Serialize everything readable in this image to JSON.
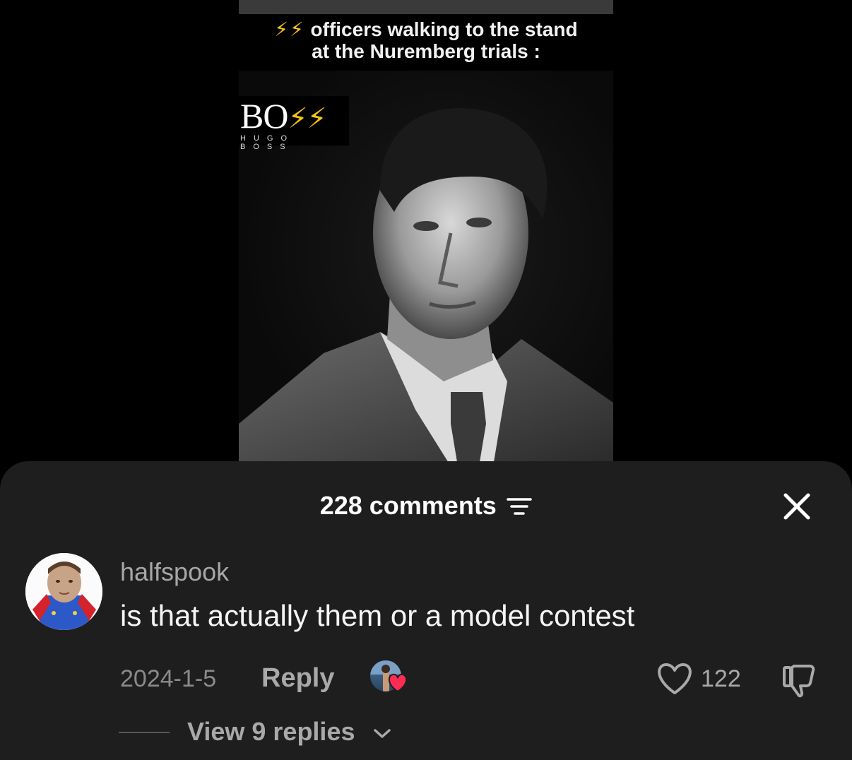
{
  "video": {
    "caption_bolts": "⚡⚡",
    "caption_line1": "officers walking to the stand",
    "caption_line2": "at the Nuremberg trials :",
    "logo_word": "BO",
    "logo_bolts": "⚡⚡",
    "logo_sub": "HUGO BOSS"
  },
  "comments": {
    "count_label": "228 comments",
    "filter_icon": "filter-icon",
    "close_icon": "close-icon"
  },
  "comment": {
    "username": "halfspook",
    "text": "is that actually them or a model contest",
    "date": "2024-1-5",
    "reply_label": "Reply",
    "like_count": "122",
    "view_replies_label": "View 9 replies"
  },
  "colors": {
    "sheet_bg": "#1e1e1e",
    "accent_heart": "#fe2c55",
    "bolt": "#f2c318"
  }
}
